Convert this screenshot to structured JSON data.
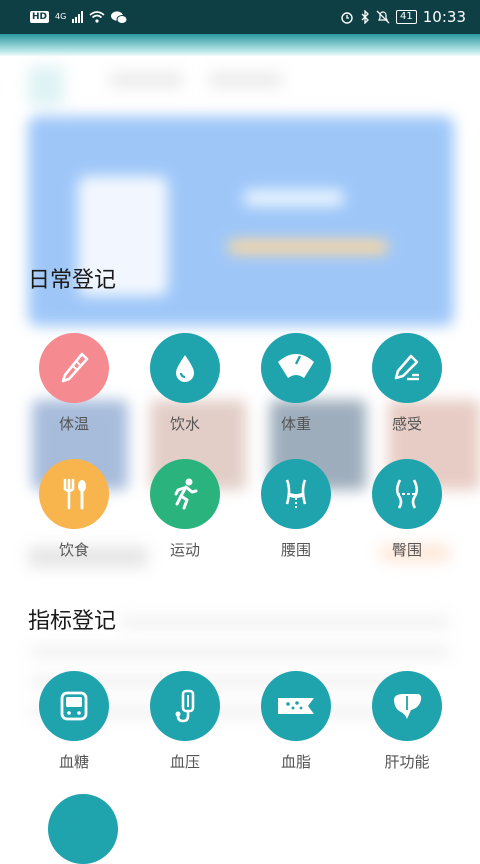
{
  "status_bar": {
    "hd": "HD",
    "network": "4G",
    "battery": "41",
    "time": "10:33"
  },
  "sections": {
    "daily": {
      "title": "日常登记",
      "items": [
        {
          "label": "体温",
          "icon": "thermometer-icon"
        },
        {
          "label": "饮水",
          "icon": "water-drop-icon"
        },
        {
          "label": "体重",
          "icon": "weight-scale-icon"
        },
        {
          "label": "感受",
          "icon": "pen-icon"
        },
        {
          "label": "饮食",
          "icon": "fork-spoon-icon"
        },
        {
          "label": "运动",
          "icon": "runner-icon"
        },
        {
          "label": "腰围",
          "icon": "waist-icon"
        },
        {
          "label": "臀围",
          "icon": "hip-icon"
        }
      ]
    },
    "indicator": {
      "title": "指标登记",
      "items": [
        {
          "label": "血糖",
          "icon": "glucose-meter-icon"
        },
        {
          "label": "血压",
          "icon": "blood-pressure-icon"
        },
        {
          "label": "血脂",
          "icon": "blood-vessel-icon"
        },
        {
          "label": "肝功能",
          "icon": "liver-icon"
        }
      ]
    }
  },
  "colors": {
    "teal": "#1fa3ad",
    "pink": "#f58a90",
    "orange": "#f8b44d",
    "green": "#2bb37e"
  }
}
